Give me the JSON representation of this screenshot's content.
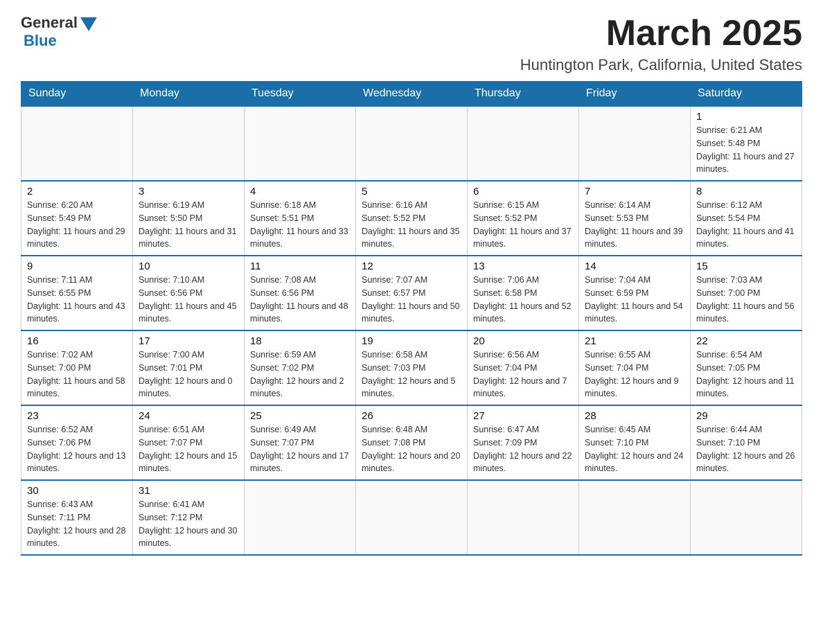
{
  "header": {
    "logo_general": "General",
    "logo_blue": "Blue",
    "month_title": "March 2025",
    "location": "Huntington Park, California, United States"
  },
  "weekdays": [
    "Sunday",
    "Monday",
    "Tuesday",
    "Wednesday",
    "Thursday",
    "Friday",
    "Saturday"
  ],
  "weeks": [
    [
      {
        "day": "",
        "sunrise": "",
        "sunset": "",
        "daylight": ""
      },
      {
        "day": "",
        "sunrise": "",
        "sunset": "",
        "daylight": ""
      },
      {
        "day": "",
        "sunrise": "",
        "sunset": "",
        "daylight": ""
      },
      {
        "day": "",
        "sunrise": "",
        "sunset": "",
        "daylight": ""
      },
      {
        "day": "",
        "sunrise": "",
        "sunset": "",
        "daylight": ""
      },
      {
        "day": "",
        "sunrise": "",
        "sunset": "",
        "daylight": ""
      },
      {
        "day": "1",
        "sunrise": "Sunrise: 6:21 AM",
        "sunset": "Sunset: 5:48 PM",
        "daylight": "Daylight: 11 hours and 27 minutes."
      }
    ],
    [
      {
        "day": "2",
        "sunrise": "Sunrise: 6:20 AM",
        "sunset": "Sunset: 5:49 PM",
        "daylight": "Daylight: 11 hours and 29 minutes."
      },
      {
        "day": "3",
        "sunrise": "Sunrise: 6:19 AM",
        "sunset": "Sunset: 5:50 PM",
        "daylight": "Daylight: 11 hours and 31 minutes."
      },
      {
        "day": "4",
        "sunrise": "Sunrise: 6:18 AM",
        "sunset": "Sunset: 5:51 PM",
        "daylight": "Daylight: 11 hours and 33 minutes."
      },
      {
        "day": "5",
        "sunrise": "Sunrise: 6:16 AM",
        "sunset": "Sunset: 5:52 PM",
        "daylight": "Daylight: 11 hours and 35 minutes."
      },
      {
        "day": "6",
        "sunrise": "Sunrise: 6:15 AM",
        "sunset": "Sunset: 5:52 PM",
        "daylight": "Daylight: 11 hours and 37 minutes."
      },
      {
        "day": "7",
        "sunrise": "Sunrise: 6:14 AM",
        "sunset": "Sunset: 5:53 PM",
        "daylight": "Daylight: 11 hours and 39 minutes."
      },
      {
        "day": "8",
        "sunrise": "Sunrise: 6:12 AM",
        "sunset": "Sunset: 5:54 PM",
        "daylight": "Daylight: 11 hours and 41 minutes."
      }
    ],
    [
      {
        "day": "9",
        "sunrise": "Sunrise: 7:11 AM",
        "sunset": "Sunset: 6:55 PM",
        "daylight": "Daylight: 11 hours and 43 minutes."
      },
      {
        "day": "10",
        "sunrise": "Sunrise: 7:10 AM",
        "sunset": "Sunset: 6:56 PM",
        "daylight": "Daylight: 11 hours and 45 minutes."
      },
      {
        "day": "11",
        "sunrise": "Sunrise: 7:08 AM",
        "sunset": "Sunset: 6:56 PM",
        "daylight": "Daylight: 11 hours and 48 minutes."
      },
      {
        "day": "12",
        "sunrise": "Sunrise: 7:07 AM",
        "sunset": "Sunset: 6:57 PM",
        "daylight": "Daylight: 11 hours and 50 minutes."
      },
      {
        "day": "13",
        "sunrise": "Sunrise: 7:06 AM",
        "sunset": "Sunset: 6:58 PM",
        "daylight": "Daylight: 11 hours and 52 minutes."
      },
      {
        "day": "14",
        "sunrise": "Sunrise: 7:04 AM",
        "sunset": "Sunset: 6:59 PM",
        "daylight": "Daylight: 11 hours and 54 minutes."
      },
      {
        "day": "15",
        "sunrise": "Sunrise: 7:03 AM",
        "sunset": "Sunset: 7:00 PM",
        "daylight": "Daylight: 11 hours and 56 minutes."
      }
    ],
    [
      {
        "day": "16",
        "sunrise": "Sunrise: 7:02 AM",
        "sunset": "Sunset: 7:00 PM",
        "daylight": "Daylight: 11 hours and 58 minutes."
      },
      {
        "day": "17",
        "sunrise": "Sunrise: 7:00 AM",
        "sunset": "Sunset: 7:01 PM",
        "daylight": "Daylight: 12 hours and 0 minutes."
      },
      {
        "day": "18",
        "sunrise": "Sunrise: 6:59 AM",
        "sunset": "Sunset: 7:02 PM",
        "daylight": "Daylight: 12 hours and 2 minutes."
      },
      {
        "day": "19",
        "sunrise": "Sunrise: 6:58 AM",
        "sunset": "Sunset: 7:03 PM",
        "daylight": "Daylight: 12 hours and 5 minutes."
      },
      {
        "day": "20",
        "sunrise": "Sunrise: 6:56 AM",
        "sunset": "Sunset: 7:04 PM",
        "daylight": "Daylight: 12 hours and 7 minutes."
      },
      {
        "day": "21",
        "sunrise": "Sunrise: 6:55 AM",
        "sunset": "Sunset: 7:04 PM",
        "daylight": "Daylight: 12 hours and 9 minutes."
      },
      {
        "day": "22",
        "sunrise": "Sunrise: 6:54 AM",
        "sunset": "Sunset: 7:05 PM",
        "daylight": "Daylight: 12 hours and 11 minutes."
      }
    ],
    [
      {
        "day": "23",
        "sunrise": "Sunrise: 6:52 AM",
        "sunset": "Sunset: 7:06 PM",
        "daylight": "Daylight: 12 hours and 13 minutes."
      },
      {
        "day": "24",
        "sunrise": "Sunrise: 6:51 AM",
        "sunset": "Sunset: 7:07 PM",
        "daylight": "Daylight: 12 hours and 15 minutes."
      },
      {
        "day": "25",
        "sunrise": "Sunrise: 6:49 AM",
        "sunset": "Sunset: 7:07 PM",
        "daylight": "Daylight: 12 hours and 17 minutes."
      },
      {
        "day": "26",
        "sunrise": "Sunrise: 6:48 AM",
        "sunset": "Sunset: 7:08 PM",
        "daylight": "Daylight: 12 hours and 20 minutes."
      },
      {
        "day": "27",
        "sunrise": "Sunrise: 6:47 AM",
        "sunset": "Sunset: 7:09 PM",
        "daylight": "Daylight: 12 hours and 22 minutes."
      },
      {
        "day": "28",
        "sunrise": "Sunrise: 6:45 AM",
        "sunset": "Sunset: 7:10 PM",
        "daylight": "Daylight: 12 hours and 24 minutes."
      },
      {
        "day": "29",
        "sunrise": "Sunrise: 6:44 AM",
        "sunset": "Sunset: 7:10 PM",
        "daylight": "Daylight: 12 hours and 26 minutes."
      }
    ],
    [
      {
        "day": "30",
        "sunrise": "Sunrise: 6:43 AM",
        "sunset": "Sunset: 7:11 PM",
        "daylight": "Daylight: 12 hours and 28 minutes."
      },
      {
        "day": "31",
        "sunrise": "Sunrise: 6:41 AM",
        "sunset": "Sunset: 7:12 PM",
        "daylight": "Daylight: 12 hours and 30 minutes."
      },
      {
        "day": "",
        "sunrise": "",
        "sunset": "",
        "daylight": ""
      },
      {
        "day": "",
        "sunrise": "",
        "sunset": "",
        "daylight": ""
      },
      {
        "day": "",
        "sunrise": "",
        "sunset": "",
        "daylight": ""
      },
      {
        "day": "",
        "sunrise": "",
        "sunset": "",
        "daylight": ""
      },
      {
        "day": "",
        "sunrise": "",
        "sunset": "",
        "daylight": ""
      }
    ]
  ]
}
